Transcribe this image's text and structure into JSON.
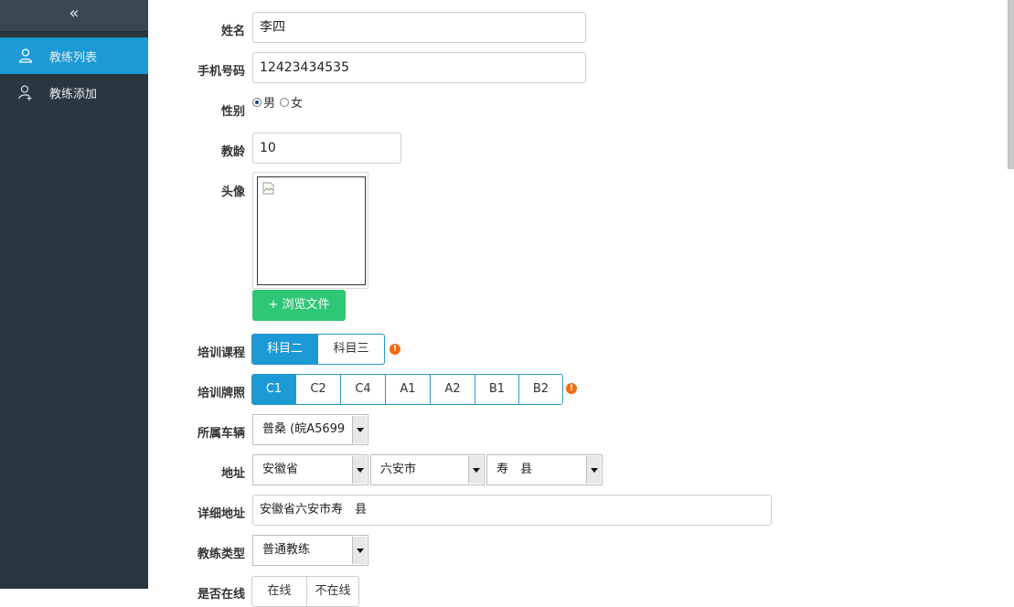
{
  "sidebar": {
    "collapse_glyph": "«",
    "items": [
      {
        "label": "教练列表",
        "icon": "user-icon",
        "active": true
      },
      {
        "label": "教练添加",
        "icon": "user-add-icon",
        "active": false
      }
    ]
  },
  "form": {
    "name": {
      "label": "姓名",
      "value": "李四"
    },
    "phone": {
      "label": "手机号码",
      "value": "12423434535"
    },
    "gender": {
      "label": "性别",
      "options": [
        "男",
        "女"
      ],
      "selected": "男"
    },
    "teaching_age": {
      "label": "教龄",
      "value": "10"
    },
    "avatar": {
      "label": "头像",
      "browse_label": "+ 浏览文件"
    },
    "course": {
      "label": "培训课程",
      "options": [
        "科目二",
        "科目三"
      ],
      "selected": "科目二",
      "warn": "!"
    },
    "license": {
      "label": "培训牌照",
      "options": [
        "C1",
        "C2",
        "C4",
        "A1",
        "A2",
        "B1",
        "B2"
      ],
      "selected": "C1",
      "warn": "!"
    },
    "vehicle": {
      "label": "所属车辆",
      "value": "普桑 (皖A5699"
    },
    "address": {
      "label": "地址",
      "province": "安徽省",
      "city": "六安市",
      "county": "寿　县"
    },
    "detail_address": {
      "label": "详细地址",
      "value": "安徽省六安市寿　县"
    },
    "coach_type": {
      "label": "教练类型",
      "value": "普通教练"
    },
    "status": {
      "label": "是否在线",
      "options": [
        "在线",
        "不在线"
      ]
    }
  },
  "colors": {
    "accent": "#1b9ad6",
    "sidebar_bg": "#2a3640",
    "success": "#2ec775",
    "warning": "#f36b10"
  }
}
